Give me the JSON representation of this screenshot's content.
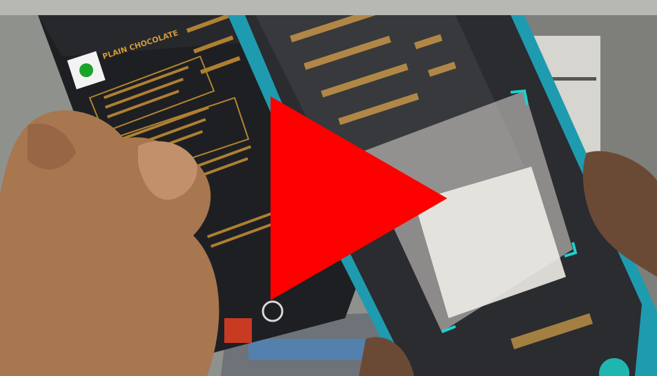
{
  "video": {
    "play_icon": "play-icon",
    "play_color": "#ff0000"
  },
  "package": {
    "title": "PLAIN CHOCOLATE"
  }
}
